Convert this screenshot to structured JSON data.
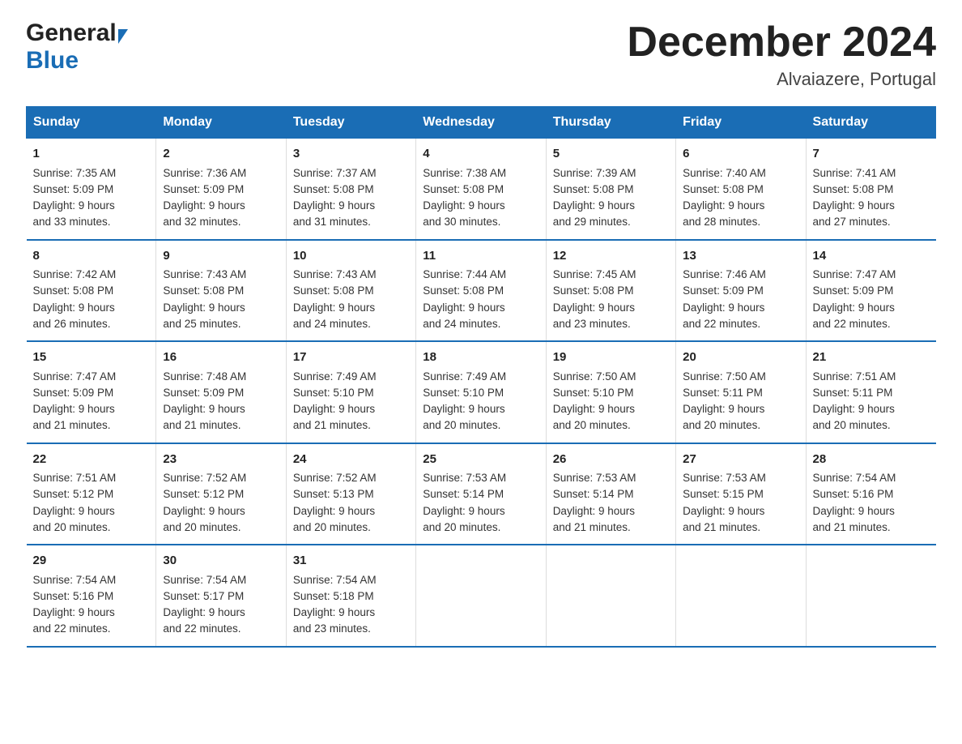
{
  "header": {
    "logo_general": "General",
    "logo_blue": "Blue",
    "month_year": "December 2024",
    "location": "Alvaiazere, Portugal"
  },
  "days_of_week": [
    "Sunday",
    "Monday",
    "Tuesday",
    "Wednesday",
    "Thursday",
    "Friday",
    "Saturday"
  ],
  "weeks": [
    [
      {
        "day": "1",
        "sunrise": "7:35 AM",
        "sunset": "5:09 PM",
        "daylight": "9 hours and 33 minutes."
      },
      {
        "day": "2",
        "sunrise": "7:36 AM",
        "sunset": "5:09 PM",
        "daylight": "9 hours and 32 minutes."
      },
      {
        "day": "3",
        "sunrise": "7:37 AM",
        "sunset": "5:08 PM",
        "daylight": "9 hours and 31 minutes."
      },
      {
        "day": "4",
        "sunrise": "7:38 AM",
        "sunset": "5:08 PM",
        "daylight": "9 hours and 30 minutes."
      },
      {
        "day": "5",
        "sunrise": "7:39 AM",
        "sunset": "5:08 PM",
        "daylight": "9 hours and 29 minutes."
      },
      {
        "day": "6",
        "sunrise": "7:40 AM",
        "sunset": "5:08 PM",
        "daylight": "9 hours and 28 minutes."
      },
      {
        "day": "7",
        "sunrise": "7:41 AM",
        "sunset": "5:08 PM",
        "daylight": "9 hours and 27 minutes."
      }
    ],
    [
      {
        "day": "8",
        "sunrise": "7:42 AM",
        "sunset": "5:08 PM",
        "daylight": "9 hours and 26 minutes."
      },
      {
        "day": "9",
        "sunrise": "7:43 AM",
        "sunset": "5:08 PM",
        "daylight": "9 hours and 25 minutes."
      },
      {
        "day": "10",
        "sunrise": "7:43 AM",
        "sunset": "5:08 PM",
        "daylight": "9 hours and 24 minutes."
      },
      {
        "day": "11",
        "sunrise": "7:44 AM",
        "sunset": "5:08 PM",
        "daylight": "9 hours and 24 minutes."
      },
      {
        "day": "12",
        "sunrise": "7:45 AM",
        "sunset": "5:08 PM",
        "daylight": "9 hours and 23 minutes."
      },
      {
        "day": "13",
        "sunrise": "7:46 AM",
        "sunset": "5:09 PM",
        "daylight": "9 hours and 22 minutes."
      },
      {
        "day": "14",
        "sunrise": "7:47 AM",
        "sunset": "5:09 PM",
        "daylight": "9 hours and 22 minutes."
      }
    ],
    [
      {
        "day": "15",
        "sunrise": "7:47 AM",
        "sunset": "5:09 PM",
        "daylight": "9 hours and 21 minutes."
      },
      {
        "day": "16",
        "sunrise": "7:48 AM",
        "sunset": "5:09 PM",
        "daylight": "9 hours and 21 minutes."
      },
      {
        "day": "17",
        "sunrise": "7:49 AM",
        "sunset": "5:10 PM",
        "daylight": "9 hours and 21 minutes."
      },
      {
        "day": "18",
        "sunrise": "7:49 AM",
        "sunset": "5:10 PM",
        "daylight": "9 hours and 20 minutes."
      },
      {
        "day": "19",
        "sunrise": "7:50 AM",
        "sunset": "5:10 PM",
        "daylight": "9 hours and 20 minutes."
      },
      {
        "day": "20",
        "sunrise": "7:50 AM",
        "sunset": "5:11 PM",
        "daylight": "9 hours and 20 minutes."
      },
      {
        "day": "21",
        "sunrise": "7:51 AM",
        "sunset": "5:11 PM",
        "daylight": "9 hours and 20 minutes."
      }
    ],
    [
      {
        "day": "22",
        "sunrise": "7:51 AM",
        "sunset": "5:12 PM",
        "daylight": "9 hours and 20 minutes."
      },
      {
        "day": "23",
        "sunrise": "7:52 AM",
        "sunset": "5:12 PM",
        "daylight": "9 hours and 20 minutes."
      },
      {
        "day": "24",
        "sunrise": "7:52 AM",
        "sunset": "5:13 PM",
        "daylight": "9 hours and 20 minutes."
      },
      {
        "day": "25",
        "sunrise": "7:53 AM",
        "sunset": "5:14 PM",
        "daylight": "9 hours and 20 minutes."
      },
      {
        "day": "26",
        "sunrise": "7:53 AM",
        "sunset": "5:14 PM",
        "daylight": "9 hours and 21 minutes."
      },
      {
        "day": "27",
        "sunrise": "7:53 AM",
        "sunset": "5:15 PM",
        "daylight": "9 hours and 21 minutes."
      },
      {
        "day": "28",
        "sunrise": "7:54 AM",
        "sunset": "5:16 PM",
        "daylight": "9 hours and 21 minutes."
      }
    ],
    [
      {
        "day": "29",
        "sunrise": "7:54 AM",
        "sunset": "5:16 PM",
        "daylight": "9 hours and 22 minutes."
      },
      {
        "day": "30",
        "sunrise": "7:54 AM",
        "sunset": "5:17 PM",
        "daylight": "9 hours and 22 minutes."
      },
      {
        "day": "31",
        "sunrise": "7:54 AM",
        "sunset": "5:18 PM",
        "daylight": "9 hours and 23 minutes."
      },
      null,
      null,
      null,
      null
    ]
  ],
  "labels": {
    "sunrise": "Sunrise:",
    "sunset": "Sunset:",
    "daylight": "Daylight:"
  }
}
